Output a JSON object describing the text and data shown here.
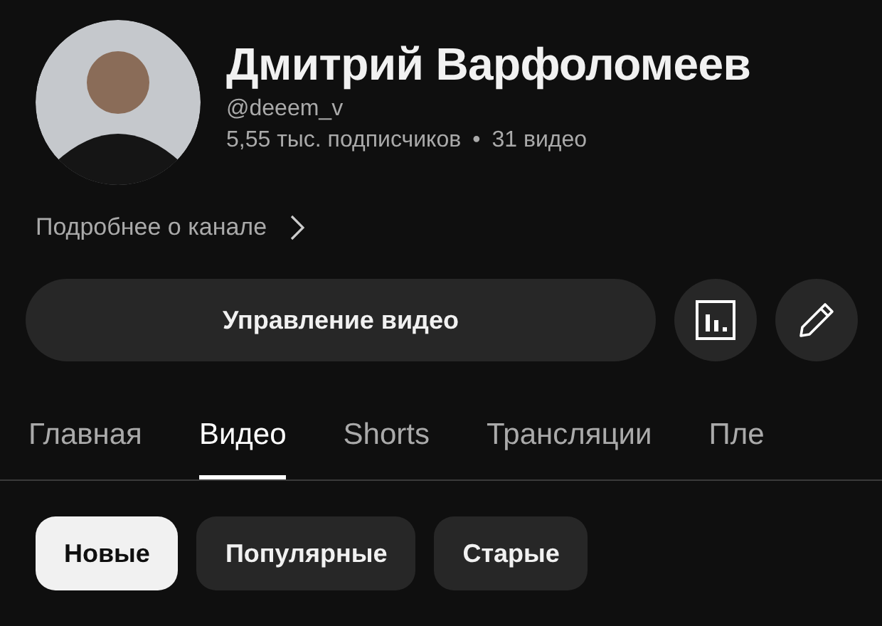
{
  "channel": {
    "name": "Дмитрий Варфоломеев",
    "handle": "@deeem_v",
    "subscribers": "5,55 тыс. подписчиков",
    "separator": "•",
    "videos": "31 видео",
    "more_link": "Подробнее о канале"
  },
  "actions": {
    "manage_button": "Управление видео"
  },
  "tabs": [
    {
      "label": "Главная",
      "selected": false
    },
    {
      "label": "Видео",
      "selected": true
    },
    {
      "label": "Shorts",
      "selected": false
    },
    {
      "label": "Трансляции",
      "selected": false
    },
    {
      "label": "Пле",
      "selected": false
    }
  ],
  "filters": [
    {
      "label": "Новые",
      "selected": true
    },
    {
      "label": "Популярные",
      "selected": false
    },
    {
      "label": "Старые",
      "selected": false
    }
  ]
}
